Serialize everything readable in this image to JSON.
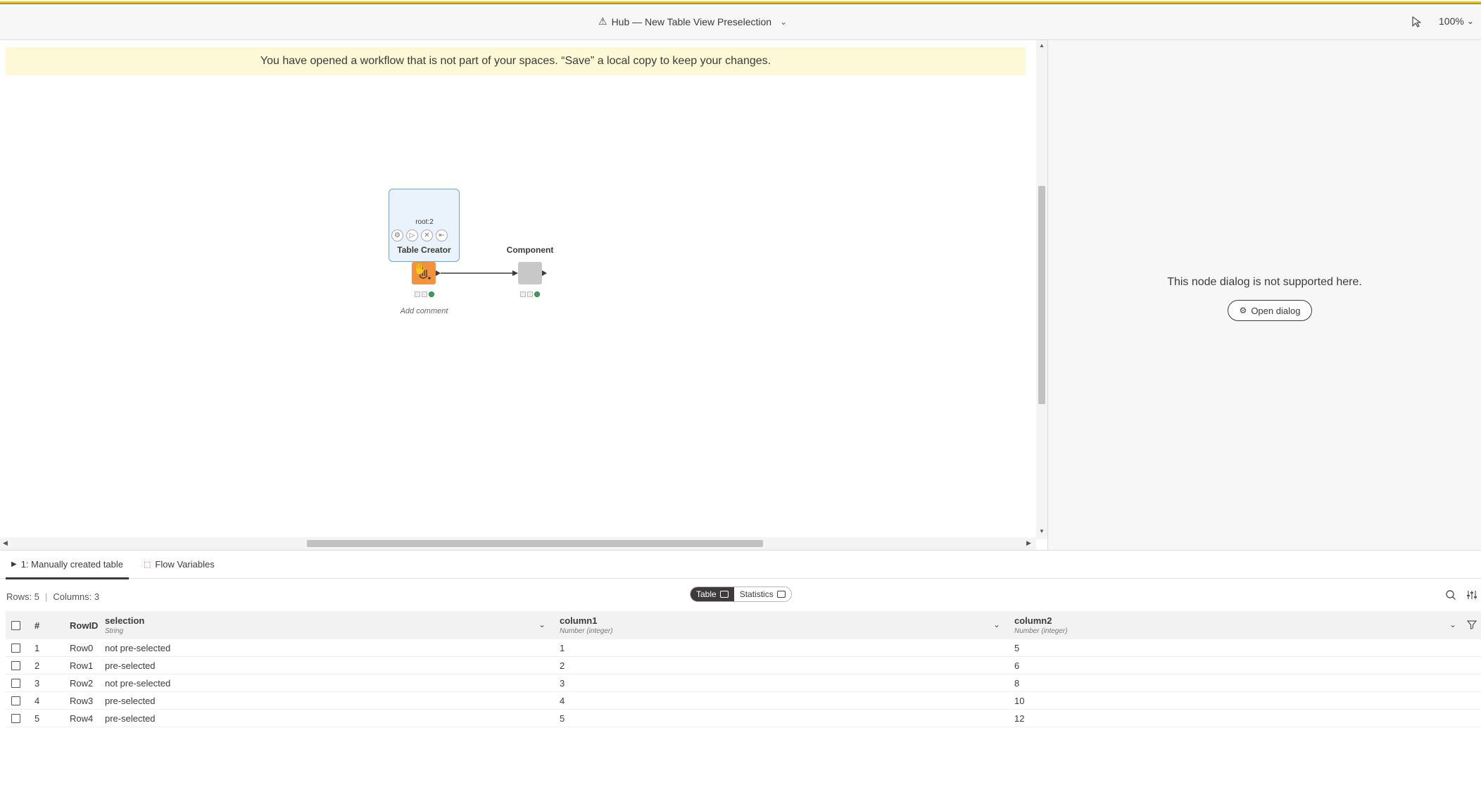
{
  "header": {
    "title": "Hub — New Table View Preselection",
    "zoom": "100%"
  },
  "banner": {
    "text": "You have opened a workflow that is not part of your spaces. “Save” a local copy to keep your changes."
  },
  "workflow": {
    "node1": {
      "id_label": "root:2",
      "name": "Table Creator",
      "comment": "Add comment"
    },
    "node2": {
      "name": "Component"
    }
  },
  "right_panel": {
    "message": "This node dialog is not supported here.",
    "open_button": "Open dialog"
  },
  "bottom": {
    "tabs": [
      {
        "label": "1: Manually created table"
      },
      {
        "label": "Flow Variables"
      }
    ],
    "rows_info": "Rows: 5",
    "cols_info": "Columns: 3",
    "view_toggle": {
      "table": "Table",
      "statistics": "Statistics"
    }
  },
  "table": {
    "columns": [
      {
        "label": "#",
        "type": ""
      },
      {
        "label": "RowID",
        "type": ""
      },
      {
        "label": "selection",
        "type": "String"
      },
      {
        "label": "column1",
        "type": "Number (integer)"
      },
      {
        "label": "column2",
        "type": "Number (integer)"
      }
    ],
    "rows": [
      {
        "num": "1",
        "rowid": "Row0",
        "selection": "not pre-selected",
        "column1": "1",
        "column2": "5"
      },
      {
        "num": "2",
        "rowid": "Row1",
        "selection": "pre-selected",
        "column1": "2",
        "column2": "6"
      },
      {
        "num": "3",
        "rowid": "Row2",
        "selection": "not pre-selected",
        "column1": "3",
        "column2": "8"
      },
      {
        "num": "4",
        "rowid": "Row3",
        "selection": "pre-selected",
        "column1": "4",
        "column2": "10"
      },
      {
        "num": "5",
        "rowid": "Row4",
        "selection": "pre-selected",
        "column1": "5",
        "column2": "12"
      }
    ]
  },
  "colors": {
    "accent": "#e8c000",
    "banner_bg": "#fdf8d5",
    "node_orange": "#f2933c",
    "status_ok": "#3aa05a"
  }
}
